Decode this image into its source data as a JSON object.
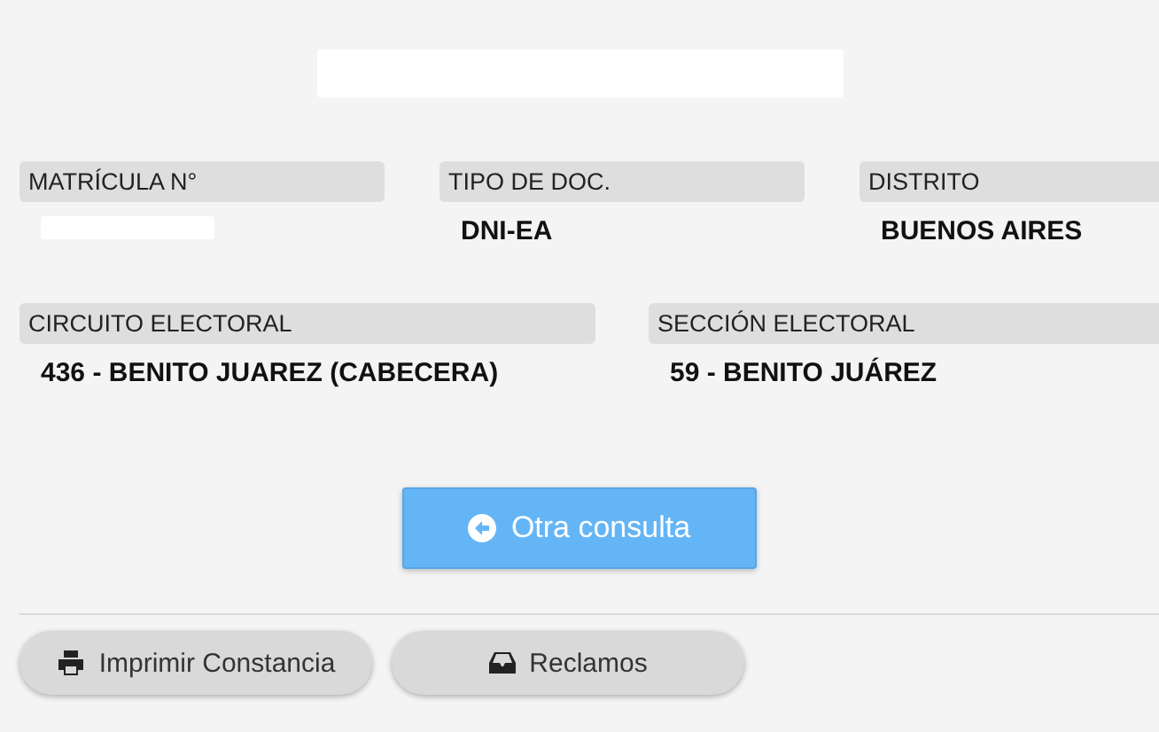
{
  "fields_row_1": [
    {
      "label": "MATRÍCULA N°"
    },
    {
      "label": "TIPO DE DOC.",
      "value": "DNI-EA"
    },
    {
      "label": "DISTRITO",
      "value": "BUENOS AIRES"
    }
  ],
  "fields_row_2": [
    {
      "label": "CIRCUITO ELECTORAL",
      "value": "436 - BENITO JUAREZ (CABECERA)"
    },
    {
      "label": "SECCIÓN ELECTORAL",
      "value": "59 - BENITO JUÁREZ"
    }
  ],
  "primary_button": {
    "label": "Otra consulta"
  },
  "footer_buttons": [
    {
      "kind": "print",
      "label": "Imprimir Constancia"
    },
    {
      "kind": "inbox",
      "label": "Reclamos"
    }
  ]
}
